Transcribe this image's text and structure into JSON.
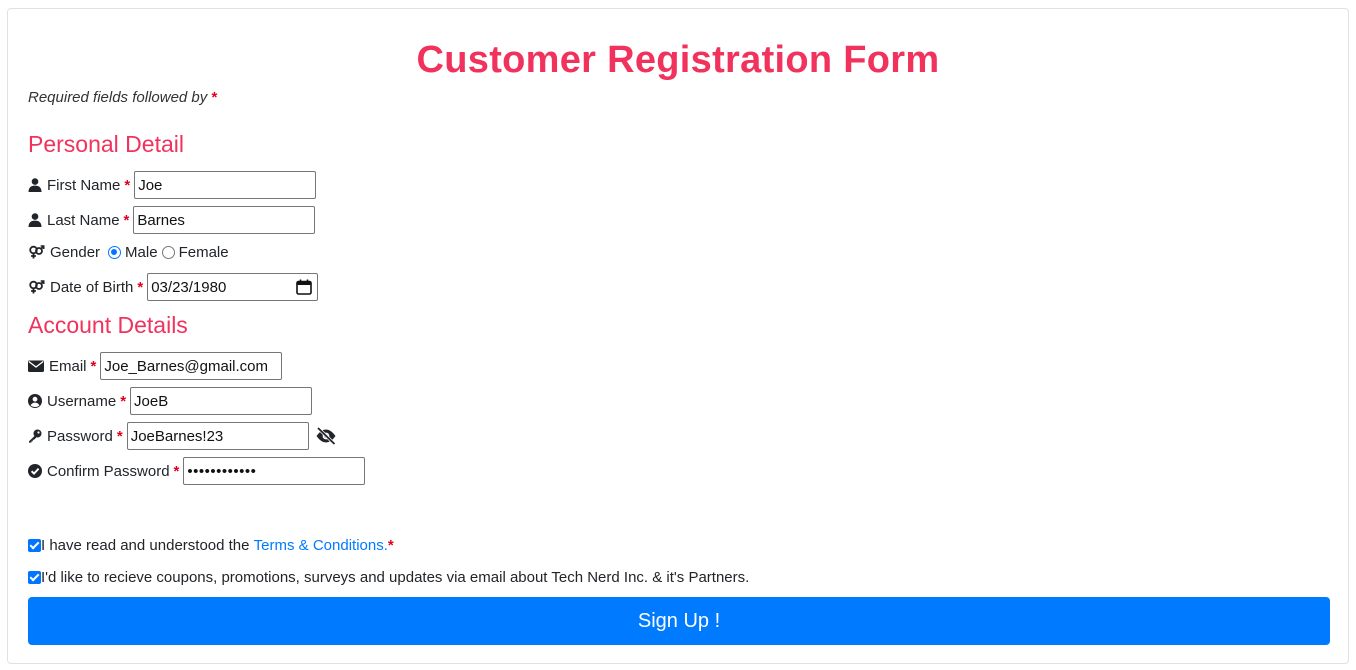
{
  "form": {
    "title": "Customer Registration Form",
    "required_note": "Required fields followed by",
    "required_marker": "*"
  },
  "personal": {
    "heading": "Personal Detail",
    "first_name": {
      "label": "First Name",
      "value": "Joe",
      "icon": "user-icon"
    },
    "last_name": {
      "label": "Last Name",
      "value": "Barnes",
      "icon": "user-icon"
    },
    "gender": {
      "label": "Gender",
      "icon": "gender-icon",
      "options": [
        "Male",
        "Female"
      ],
      "selected": "Male"
    },
    "dob": {
      "label": "Date of Birth",
      "value": "03/23/1980",
      "icon": "gender-icon"
    }
  },
  "account": {
    "heading": "Account Details",
    "email": {
      "label": "Email",
      "value": "Joe_Barnes@gmail.com",
      "icon": "envelope-icon"
    },
    "username": {
      "label": "Username",
      "value": "JoeB",
      "icon": "user-circle-icon"
    },
    "password": {
      "label": "Password",
      "value": "JoeBarnes!23",
      "icon": "key-icon",
      "toggle_icon": "eye-slash-icon"
    },
    "confirm_password": {
      "label": "Confirm Password",
      "value": "••••••••••••",
      "icon": "check-circle-icon"
    }
  },
  "agreements": {
    "terms_prefix": "I have read and understood the",
    "terms_link": "Terms & Conditions",
    "terms_suffix": ".",
    "terms_checked": true,
    "marketing_text": "I'd like to recieve coupons, promotions, surveys and updates via email about Tech Nerd Inc. & it's Partners.",
    "marketing_checked": true
  },
  "actions": {
    "submit_label": "Sign Up !"
  },
  "colors": {
    "accent": "#f0325c",
    "primary": "#007bff",
    "required": "#e0001b"
  }
}
